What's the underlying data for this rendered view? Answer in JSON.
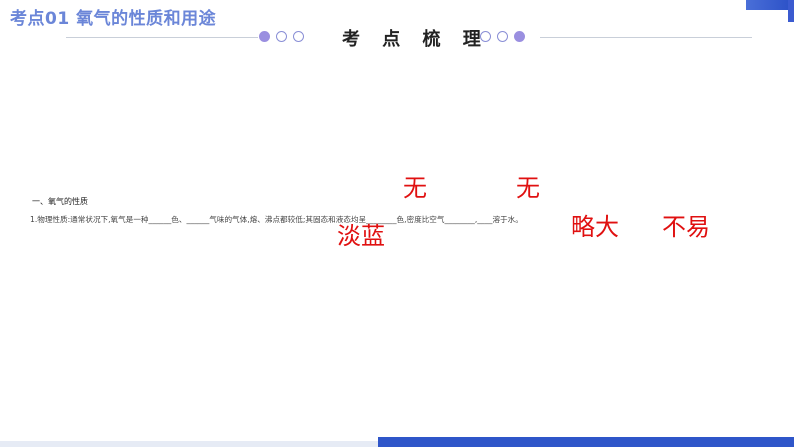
{
  "header": {
    "title": "考点01  氧气的性质和用途",
    "section_title": "考 点 梳 理"
  },
  "content": {
    "heading": "一、氧气的性质",
    "line1": "1.物理性质:通常状况下,氧气是一种______色、______气味的气体,熔、沸点都较低;其固态和液态均呈________色,密度比空气________,____溶于水。"
  },
  "answers": {
    "color_gas": "无",
    "odor": "无",
    "solid_liquid_color": "淡蓝",
    "density": "略大",
    "solubility": "不易"
  },
  "colors": {
    "accent": "#6b86d8",
    "answer_red": "#e01010",
    "band_blue": "#2f56c9",
    "dot_purple": "#9a8fe0"
  }
}
